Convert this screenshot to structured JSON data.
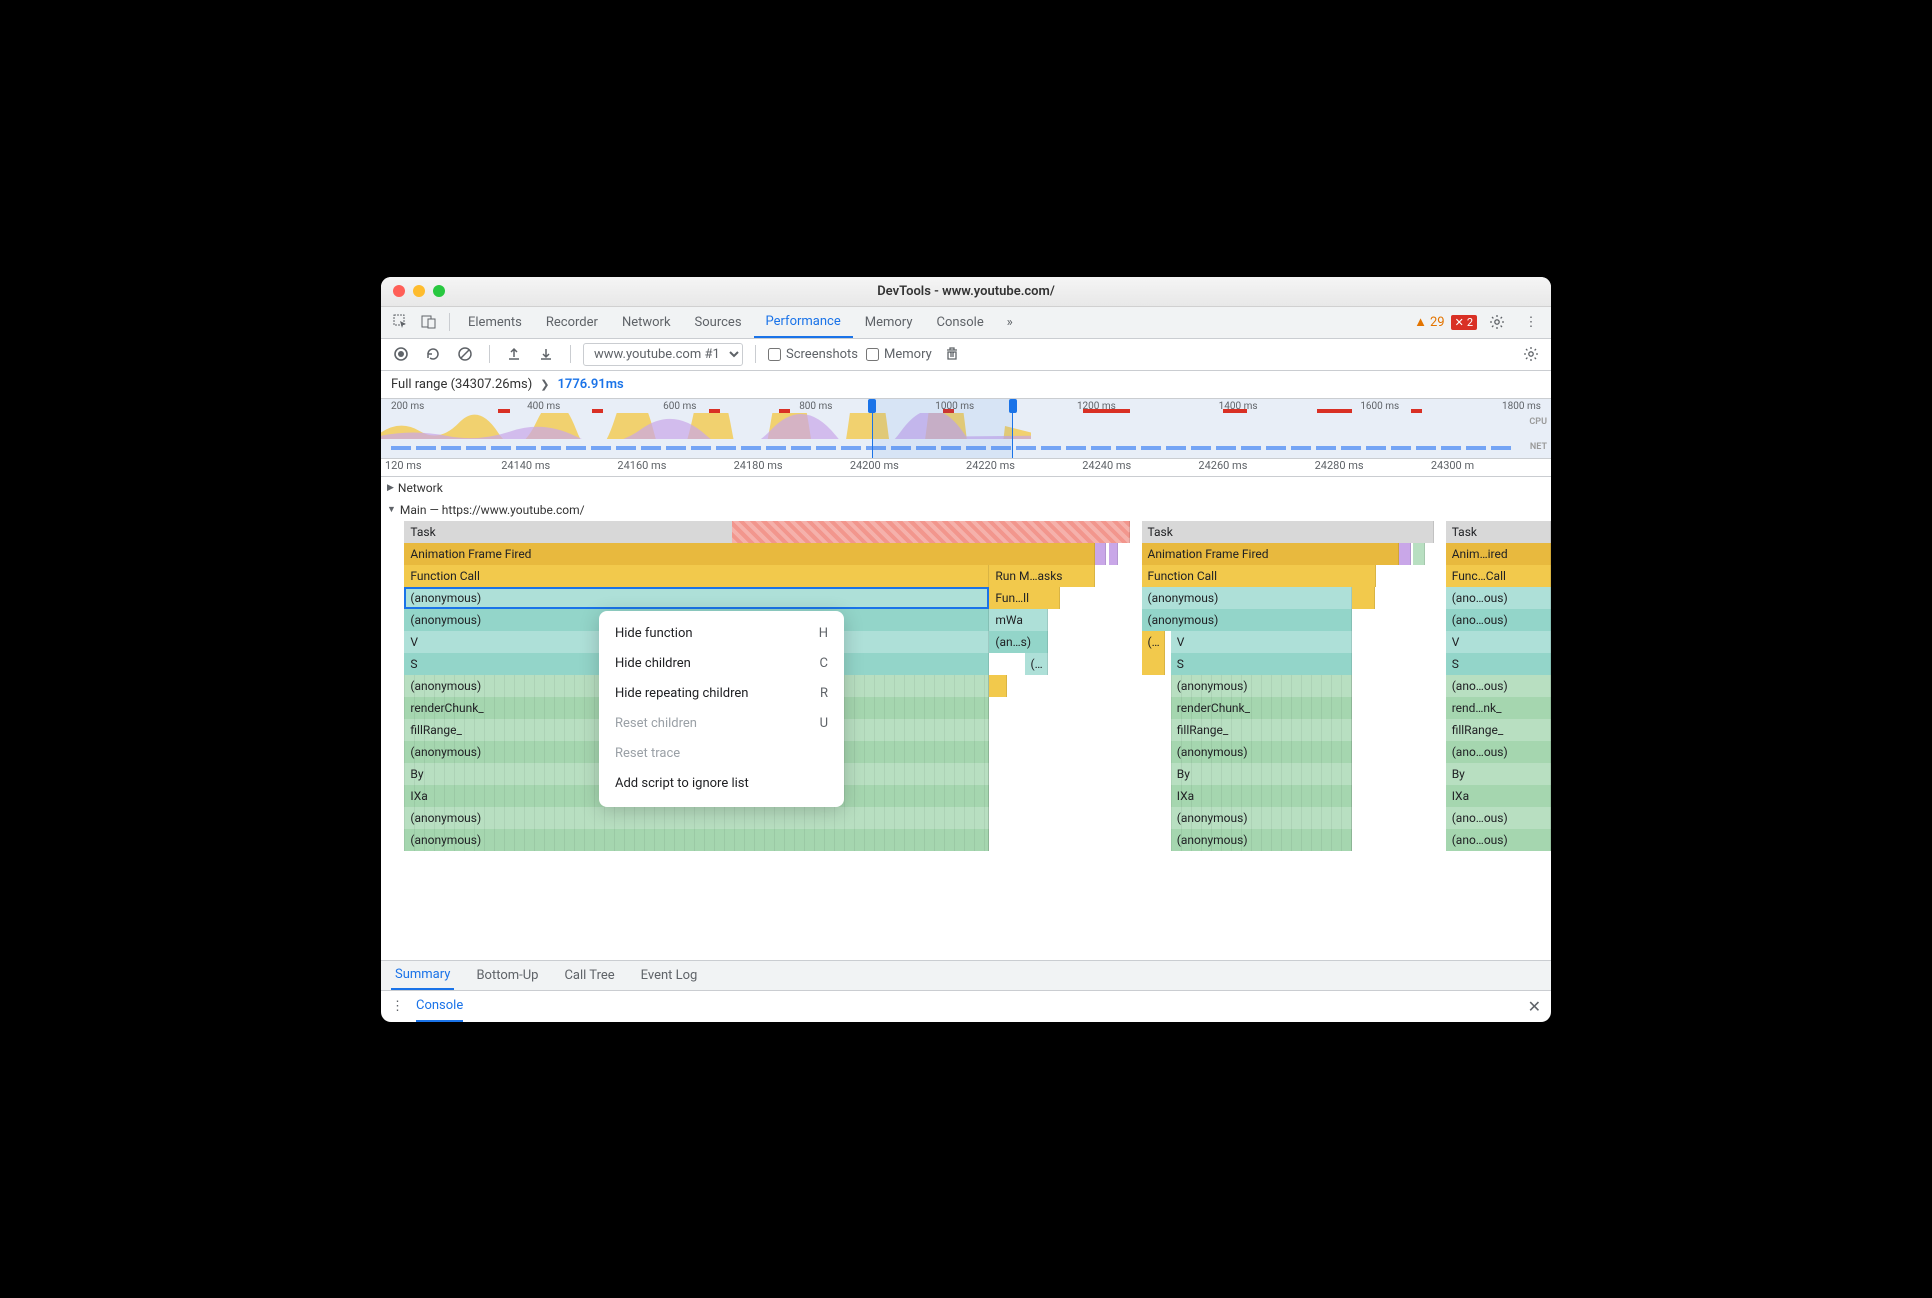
{
  "window_title": "DevTools - www.youtube.com/",
  "tabs": [
    "Elements",
    "Recorder",
    "Network",
    "Sources",
    "Performance",
    "Memory",
    "Console"
  ],
  "active_tab": "Performance",
  "warning_count": "29",
  "error_count": "2",
  "recording_dropdown": "www.youtube.com #1",
  "screenshots_label": "Screenshots",
  "memory_label": "Memory",
  "breadcrumb_full": "Full range (34307.26ms)",
  "breadcrumb_current": "1776.91ms",
  "overview_ticks": [
    "200 ms",
    "400 ms",
    "600 ms",
    "800 ms",
    "1000 ms",
    "1200 ms",
    "1400 ms",
    "1600 ms",
    "1800 ms"
  ],
  "overview_cpu_label": "CPU",
  "overview_net_label": "NET",
  "detail_ticks": [
    "120 ms",
    "24140 ms",
    "24160 ms",
    "24180 ms",
    "24200 ms",
    "24220 ms",
    "24240 ms",
    "24260 ms",
    "24280 ms",
    "24300 m"
  ],
  "network_track": "Network",
  "main_track": "Main — https://www.youtube.com/",
  "flame": {
    "task": "Task",
    "anim": "Animation Frame Fired",
    "anim3": "Anim…ired",
    "func": "Function Call",
    "func3": "Func…Call",
    "runm": "Run M…asks",
    "anon": "(anonymous)",
    "anon3a": "(ano…ous)",
    "anon3b": "(ano…ous)",
    "funll": "Fun…ll",
    "mwa": "mWa",
    "ans": "(an…s)",
    "dots": "(…",
    "v": "V",
    "s": "S",
    "renderchunk": "renderChunk_",
    "renderchunk3": "rend…nk_",
    "fillrange": "fillRange_",
    "by": "By",
    "ixa": "IXa"
  },
  "context_menu": [
    {
      "label": "Hide function",
      "key": "H",
      "enabled": true
    },
    {
      "label": "Hide children",
      "key": "C",
      "enabled": true
    },
    {
      "label": "Hide repeating children",
      "key": "R",
      "enabled": true
    },
    {
      "label": "Reset children",
      "key": "U",
      "enabled": false
    },
    {
      "label": "Reset trace",
      "key": "",
      "enabled": false
    },
    {
      "label": "Add script to ignore list",
      "key": "",
      "enabled": true
    }
  ],
  "bottom_tabs": [
    "Summary",
    "Bottom-Up",
    "Call Tree",
    "Event Log"
  ],
  "active_bottom_tab": "Summary",
  "console_label": "Console"
}
